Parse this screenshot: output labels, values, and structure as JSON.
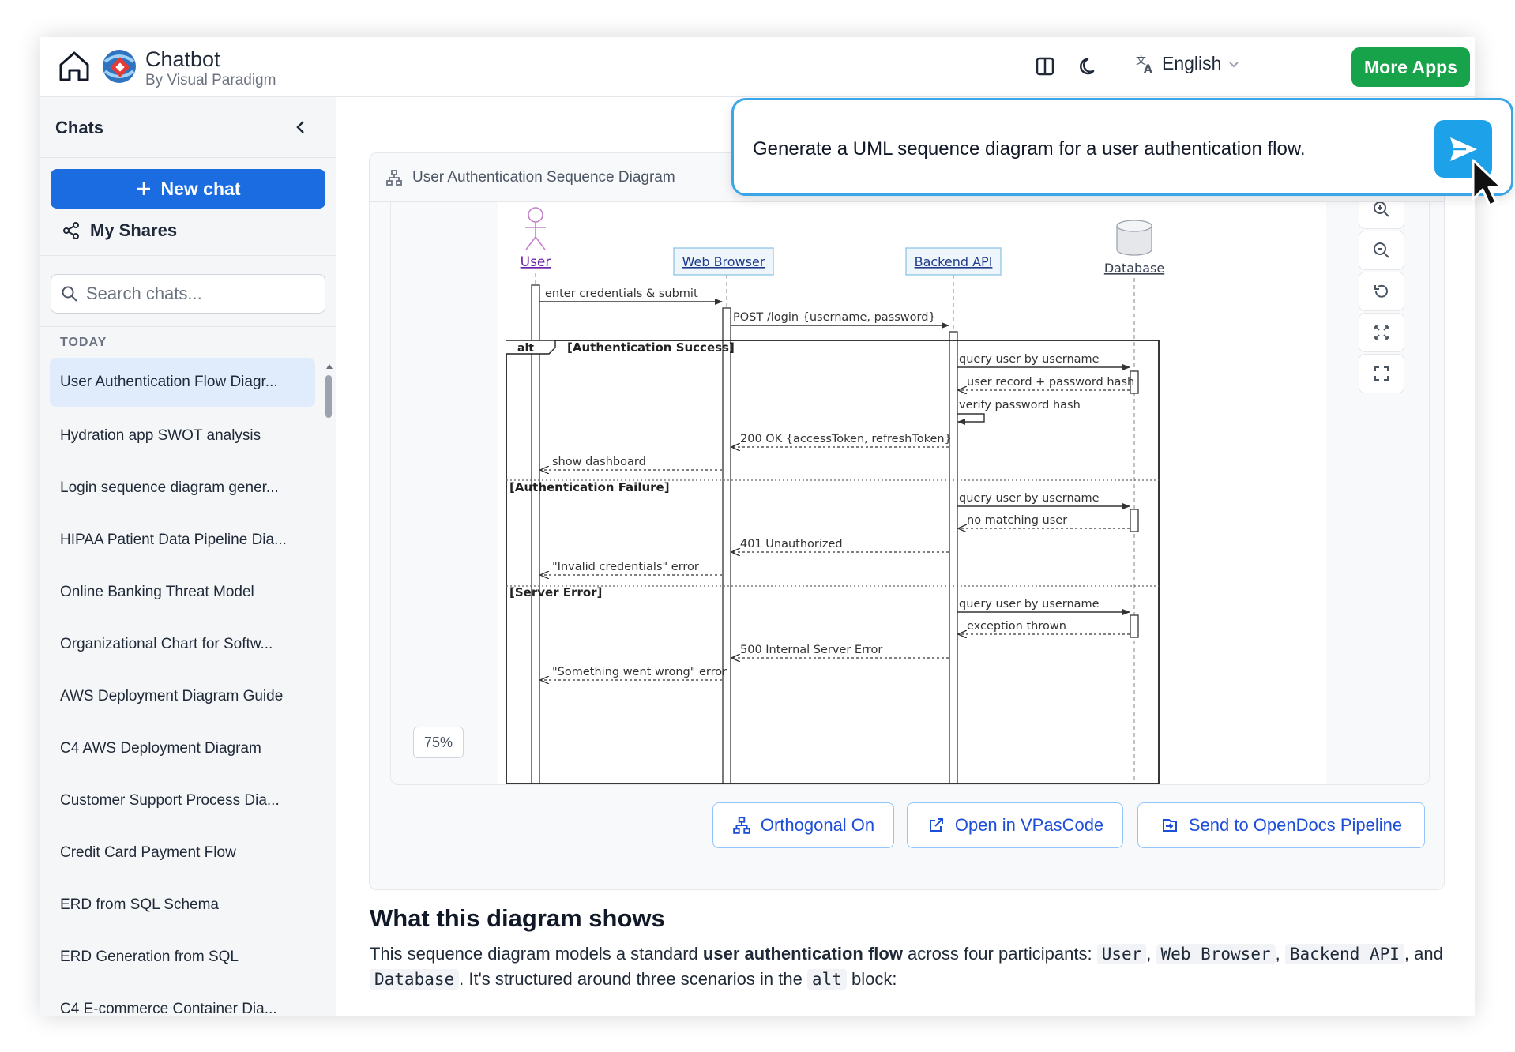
{
  "header": {
    "brand_name": "Chatbot",
    "brand_sub": "By Visual Paradigm",
    "language": "English",
    "more_apps": "More Apps"
  },
  "sidebar": {
    "title": "Chats",
    "new_chat": "New chat",
    "my_shares": "My Shares",
    "search_placeholder": "Search chats...",
    "section_label": "TODAY",
    "chats": [
      "User Authentication Flow Diagr...",
      "Hydration app SWOT analysis",
      "Login sequence diagram gener...",
      "HIPAA Patient Data Pipeline Dia...",
      "Online Banking Threat Model",
      "Organizational Chart for Softw...",
      "AWS Deployment Diagram Guide",
      "C4 AWS Deployment Diagram",
      "Customer Support Process Dia...",
      "Credit Card Payment Flow",
      "ERD from SQL Schema",
      "ERD Generation from SQL",
      "C4 E-commerce Container Dia..."
    ]
  },
  "diagram": {
    "title": "User Authentication Sequence Diagram",
    "zoom": "75%",
    "participants": [
      "User",
      "Web Browser",
      "Backend API",
      "Database"
    ],
    "fragment_operator": "alt",
    "guards": [
      "[Authentication Success]",
      "[Authentication Failure]",
      "[Server Error]"
    ],
    "messages": [
      "enter credentials & submit",
      "POST /login {username, password}",
      "query user by username",
      "user record + password hash",
      "verify password hash",
      "200 OK {accessToken, refreshToken}",
      "show dashboard",
      "query user by username",
      "no matching user",
      "401 Unauthorized",
      "\"Invalid credentials\" error",
      "query user by username",
      "exception thrown",
      "500 Internal Server Error",
      "\"Something went wrong\" error"
    ]
  },
  "actions": {
    "orthogonal": "Orthogonal On",
    "open_vpascode": "Open in VPasCode",
    "send_opendocs": "Send to OpenDocs Pipeline"
  },
  "explanation": {
    "title": "What this diagram shows",
    "p1": "This sequence diagram models a standard ",
    "p1_bold": "user authentication flow",
    "p2": " across four participants: ",
    "code_user": "User",
    "sep1": ", ",
    "code_browser": "Web Browser",
    "sep2": ", ",
    "code_backend": "Backend API",
    "p3": ", and ",
    "code_db": "Database",
    "p4": ". It's structured around three scenarios in the ",
    "code_alt": "alt",
    "p5": " block:"
  },
  "prompt": {
    "text": "Generate a UML sequence diagram for a user authentication flow."
  }
}
